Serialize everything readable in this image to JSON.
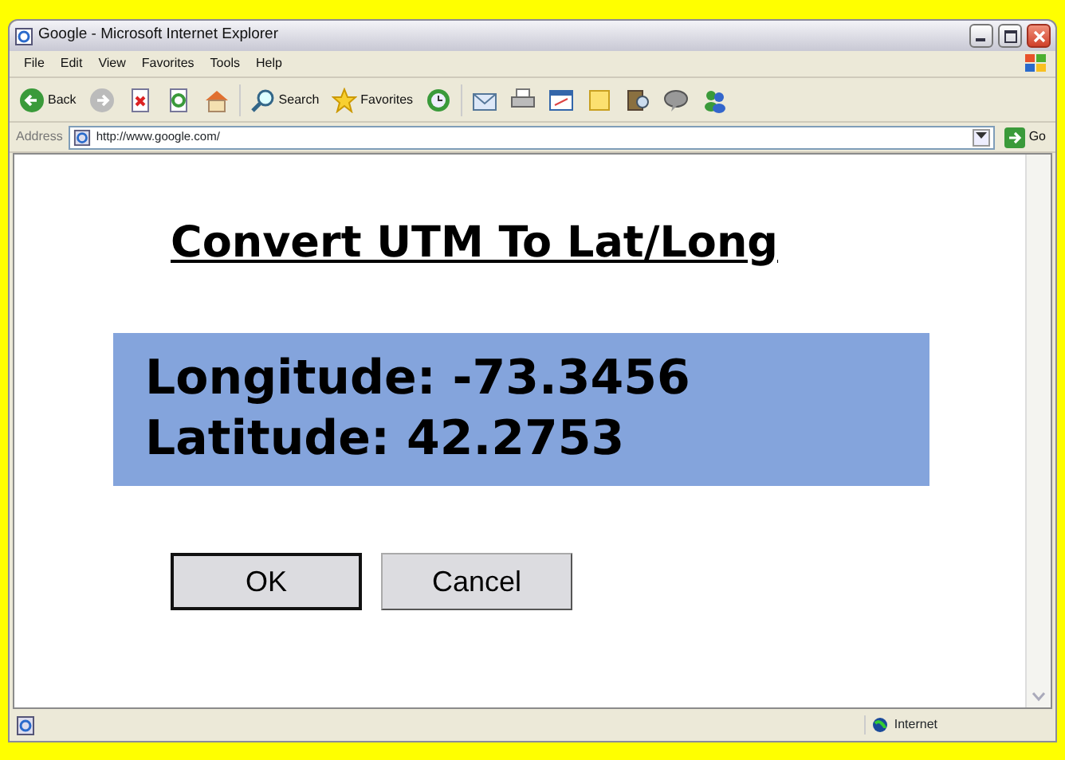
{
  "window": {
    "title": "Google - Microsoft Internet Explorer"
  },
  "menu": [
    "File",
    "Edit",
    "View",
    "Favorites",
    "Tools",
    "Help"
  ],
  "toolbar": [
    {
      "kind": "back",
      "label": "Back"
    },
    {
      "kind": "forward"
    },
    {
      "kind": "stop"
    },
    {
      "kind": "refresh"
    },
    {
      "kind": "home"
    },
    {
      "kind": "search",
      "label": "Search"
    },
    {
      "kind": "favorites",
      "label": "Favorites"
    },
    {
      "kind": "history"
    },
    {
      "kind": "mail"
    },
    {
      "kind": "print"
    },
    {
      "kind": "edit"
    },
    {
      "kind": "note"
    },
    {
      "kind": "research"
    },
    {
      "kind": "messenger"
    },
    {
      "kind": "people"
    }
  ],
  "address": {
    "label": "Address",
    "value": "http://www.google.com/",
    "go": "Go"
  },
  "page": {
    "heading": "Convert UTM To Lat/Long",
    "results": [
      "Longitude: -73.3456",
      "Latitude: 42.2753"
    ],
    "buttons": [
      {
        "label": "OK",
        "default": true
      },
      {
        "label": "Cancel",
        "default": false
      }
    ]
  },
  "status_bar": {
    "zone": "Internet"
  }
}
